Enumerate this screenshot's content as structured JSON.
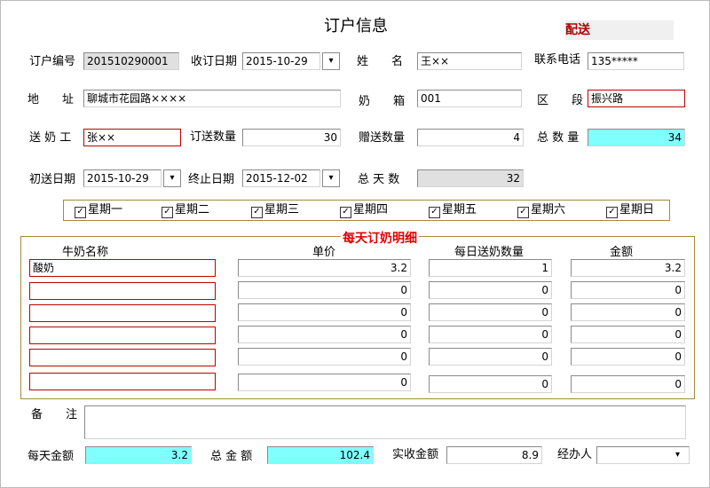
{
  "title": "订户信息",
  "tag": "配送",
  "labels": {
    "subscriber_no": "订户编号",
    "order_date": "收订日期",
    "name": "姓　　名",
    "phone": "联系电话",
    "address": "地　　址",
    "milk_box": "奶　　箱",
    "district": "区　　段",
    "courier": "送 奶 工",
    "order_qty": "订送数量",
    "gift_qty": "赠送数量",
    "total_qty": "总 数 量",
    "start_date": "初送日期",
    "end_date": "终止日期",
    "total_days": "总 天 数",
    "notes": "备　　注",
    "daily_amount": "每天金额",
    "total_amount": "总 金 额",
    "paid_amount": "实收金额",
    "handler": "经办人"
  },
  "fields": {
    "subscriber_no": "201510290001",
    "order_date": "2015-10-29",
    "name": "王××",
    "phone": "135*****",
    "address": "聊城市花园路××××",
    "milk_box": "001",
    "district": "振兴路",
    "courier": "张××",
    "order_qty": "30",
    "gift_qty": "4",
    "total_qty": "34",
    "start_date": "2015-10-29",
    "end_date": "2015-12-02",
    "total_days": "32",
    "notes": "",
    "daily_amount": "3.2",
    "total_amount": "102.4",
    "paid_amount": "8.9",
    "handler": ""
  },
  "weekdays": [
    {
      "label": "星期一",
      "checked": true
    },
    {
      "label": "星期二",
      "checked": true
    },
    {
      "label": "星期三",
      "checked": true
    },
    {
      "label": "星期四",
      "checked": true
    },
    {
      "label": "星期五",
      "checked": true
    },
    {
      "label": "星期六",
      "checked": true
    },
    {
      "label": "星期日",
      "checked": true
    }
  ],
  "detail": {
    "title": "每天订奶明细",
    "headers": [
      "牛奶名称",
      "单价",
      "每日送奶数量",
      "金额"
    ],
    "rows": [
      {
        "name": "酸奶",
        "price": "3.2",
        "qty": "1",
        "amount": "3.2"
      },
      {
        "name": "",
        "price": "0",
        "qty": "0",
        "amount": "0"
      },
      {
        "name": "",
        "price": "0",
        "qty": "0",
        "amount": "0"
      },
      {
        "name": "",
        "price": "0",
        "qty": "0",
        "amount": "0"
      },
      {
        "name": "",
        "price": "0",
        "qty": "0",
        "amount": "0"
      },
      {
        "name": "",
        "price": "0",
        "qty": "0",
        "amount": "0"
      }
    ]
  },
  "icons": {
    "dropdown": "chevron-down-icon",
    "check": "checkmark-icon"
  }
}
